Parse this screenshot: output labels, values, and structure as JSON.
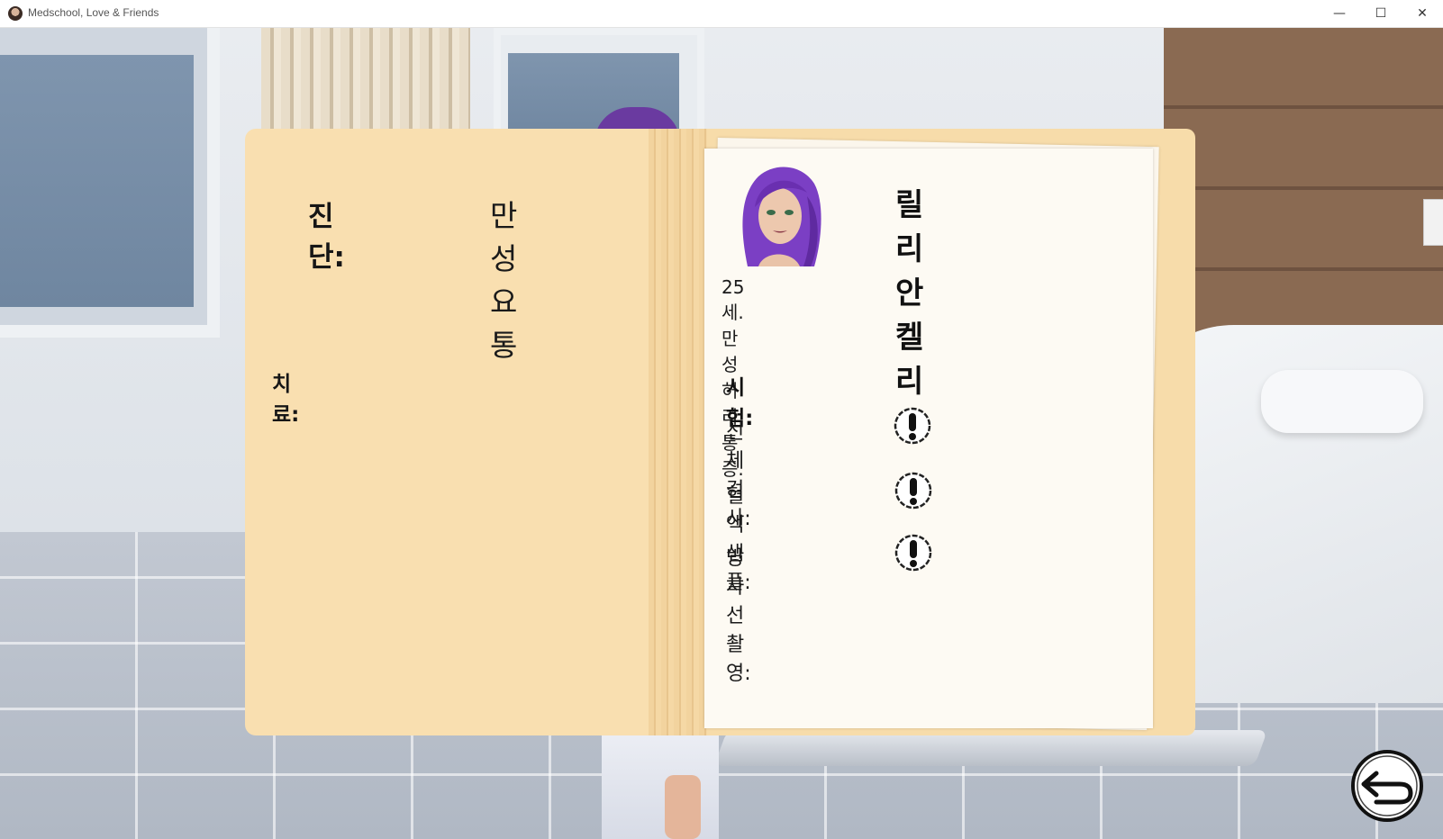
{
  "window": {
    "title": "Medschool, Love & Friends",
    "minimize": "—",
    "maximize": "☐",
    "close": "✕"
  },
  "chart_free": true,
  "folder": {
    "diagnosis_label": "진단:",
    "diagnosis_value": "만성 요통",
    "treatment_label": "치료:"
  },
  "patient": {
    "name": "릴리안 켈리",
    "description": "25세. 만성 허리 통증.",
    "hair_color": "#7b3fc4"
  },
  "exams": {
    "label": "시험:",
    "items": [
      {
        "label": "신체 검사:",
        "icon": "exclamation-icon"
      },
      {
        "label": "혈액 샘플:",
        "icon": "exclamation-icon"
      },
      {
        "label": "방사선 촬영:",
        "icon": "exclamation-icon"
      }
    ]
  },
  "nav": {
    "back_icon": "back-arrow-icon"
  }
}
